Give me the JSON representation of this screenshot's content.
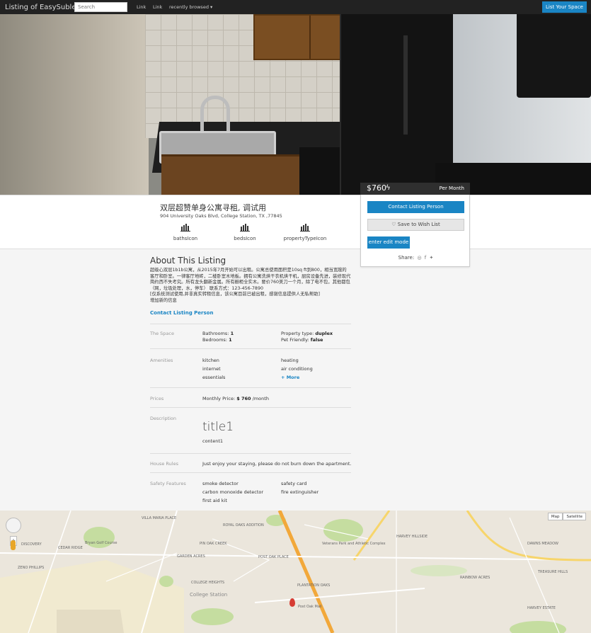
{
  "navbar": {
    "brand": "Listing of EasySublease",
    "search_placeholder": "Search",
    "link1": "Link",
    "link2": "Link",
    "recent": "recently browsed ▾",
    "cta": "List Your Space"
  },
  "listing": {
    "price": "$760",
    "price_icon": "bolt-icon",
    "period": "Per Month",
    "title": "双层超赞单身公寓寻租, 调试用",
    "address": "904 University Oaks Blvd, College Station, TX ,77845",
    "features": [
      {
        "label": "bathsIcon"
      },
      {
        "label": "bedsIcon"
      },
      {
        "label": "propertyTypeIcon"
      }
    ]
  },
  "card": {
    "contact": "Contact Listing Person",
    "wish": "♡ Save to Wish List",
    "edit": "enter edit mode",
    "share": "Share:",
    "share_icons": [
      "instagram-icon",
      "facebook-icon",
      "twitter-icon"
    ]
  },
  "about": {
    "heading": "About This Listing",
    "text": "超级心双层1b1b公寓，从2015年7月开始可以出租。公寓总使用面积是10sq ft到800，相当宽敞的客厅和卧室。一律客厅地砖，二楼卧室木地板。拥有公寓洗烘干衣机烘干机，厨房设备先进，装修现代简约西不失考究。所有龙头翻新金属。所有橱柜全实木。要价760美刀一个月，除了电不包，其他都包（网，垃圾处理，水，停车） 联系方式：123-456-7890\n[仅系统测试使用,并非真实转租信息，该公寓目前已被出租，感谢信息提供人无私帮助]\n增加新的信息",
    "contact_link": "Contact Listing Person"
  },
  "details": {
    "space_label": "The Space",
    "bathrooms_key": "Bathrooms:",
    "bathrooms_val": "1",
    "bedrooms_key": "Bedrooms:",
    "bedrooms_val": "1",
    "property_type_key": "Property type:",
    "property_type_val": "duplex",
    "pet_key": "Pet Friendly:",
    "pet_val": "false",
    "amenities_label": "Amenities",
    "amenities_left": [
      "kitchen",
      "internet",
      "essentials"
    ],
    "amenities_right": [
      "heating",
      "air conditiong"
    ],
    "more": "+ More",
    "prices_label": "Prices",
    "monthly_key": "Monthly Price:",
    "monthly_val": "$ 760",
    "monthly_unit": "/month",
    "description_label": "Description",
    "desc_title": "title1",
    "desc_content": "content1",
    "rules_label": "House Rules",
    "rules_text": "Just enjoy your staying, please do not burn down the apartment.",
    "safety_label": "Safety Features",
    "safety_left": [
      "smoke detector",
      "carbon monoxide detector",
      "first aid kit"
    ],
    "safety_right": [
      "safety card",
      "fire extinguisher"
    ]
  },
  "map": {
    "toggle_map": "Map",
    "toggle_sat": "Satellite",
    "labels": [
      "VILLA MARIA PLACE",
      "ROYAL OAKS ADDITION",
      "PIN OAK CREEK",
      "GARDEN ACRES",
      "POST OAK PLACE",
      "COLLEGE HEIGHTS",
      "DISCOVERY",
      "HARVEY HILLSIDE",
      "DAWNS MEADOW",
      "TREASURE HILLS",
      "HARVEY ESTATE",
      "RAINBOW ACRES",
      "Veterans Park and Athletic Complex",
      "Bryan Golf Course",
      "ZENO PHILLIPS",
      "CEDAR RIDGE",
      "PLANTATION OAKS",
      "Post Oak Mall"
    ],
    "city": "College Station"
  }
}
